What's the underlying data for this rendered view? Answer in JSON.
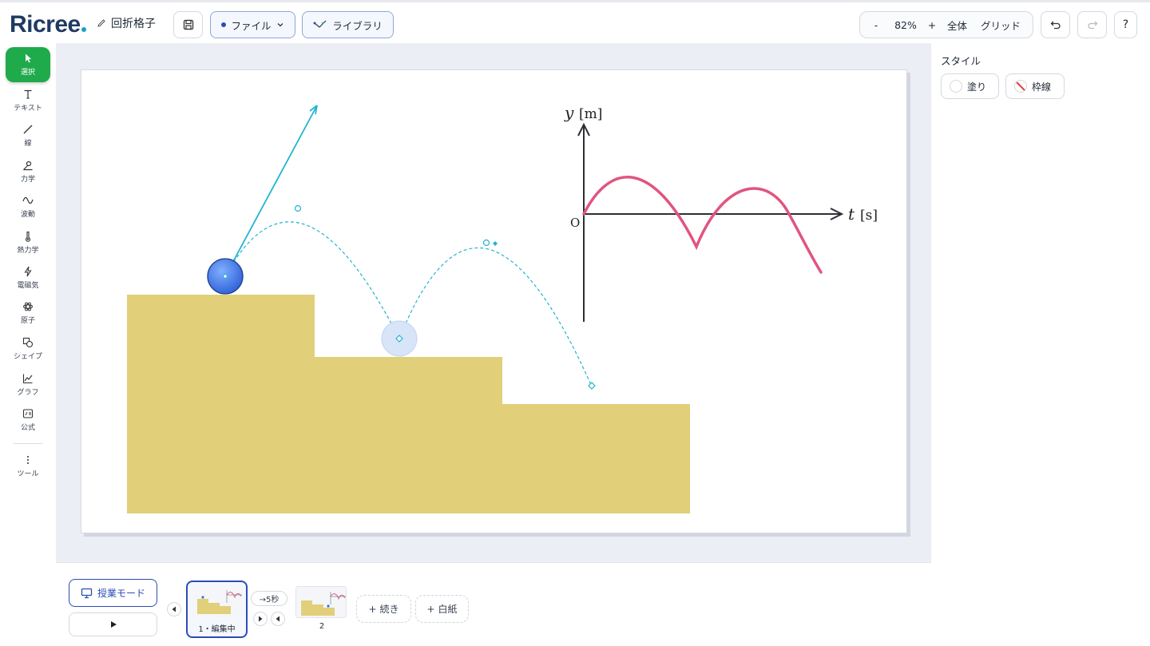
{
  "app": {
    "logo": "Ricree",
    "doc_title": "回折格子"
  },
  "toolbar": {
    "file_label": "ファイル",
    "library_label": "ライブラリ",
    "zoom_minus": "-",
    "zoom_value": "82%",
    "zoom_plus": "+",
    "fit_all": "全体",
    "grid": "グリッド",
    "help": "?"
  },
  "tools": [
    {
      "label": "選択",
      "icon": "pointer-icon",
      "active": true
    },
    {
      "label": "テキスト",
      "icon": "text-icon"
    },
    {
      "label": "線",
      "icon": "line-icon"
    },
    {
      "label": "力学",
      "icon": "mechanics-icon"
    },
    {
      "label": "波動",
      "icon": "wave-icon"
    },
    {
      "label": "熱力学",
      "icon": "thermometer-icon"
    },
    {
      "label": "電磁気",
      "icon": "lightning-icon"
    },
    {
      "label": "原子",
      "icon": "atom-icon"
    },
    {
      "label": "シェイプ",
      "icon": "shapes-icon"
    },
    {
      "label": "グラフ",
      "icon": "graph-icon"
    },
    {
      "label": "公式",
      "icon": "formula-icon"
    },
    {
      "label": "ツール",
      "icon": "more-icon"
    }
  ],
  "canvas": {
    "graph_y_label": "y",
    "graph_y_unit": "[m]",
    "graph_x_label": "t",
    "graph_x_unit": "[s]",
    "origin_label": "O",
    "colors": {
      "stairs": "#e1cf7a",
      "curve": "#e0557f",
      "trajectory": "#1fb5d1",
      "ball": "#3a6fe0"
    }
  },
  "style_panel": {
    "title": "スタイル",
    "fill_label": "塗り",
    "stroke_label": "枠線"
  },
  "slides": {
    "class_mode": "授業モード",
    "transition": "→5秒",
    "items": [
      {
        "label": "1・編集中"
      },
      {
        "label": "2"
      }
    ],
    "continue_label": "続き",
    "blank_label": "白紙"
  }
}
